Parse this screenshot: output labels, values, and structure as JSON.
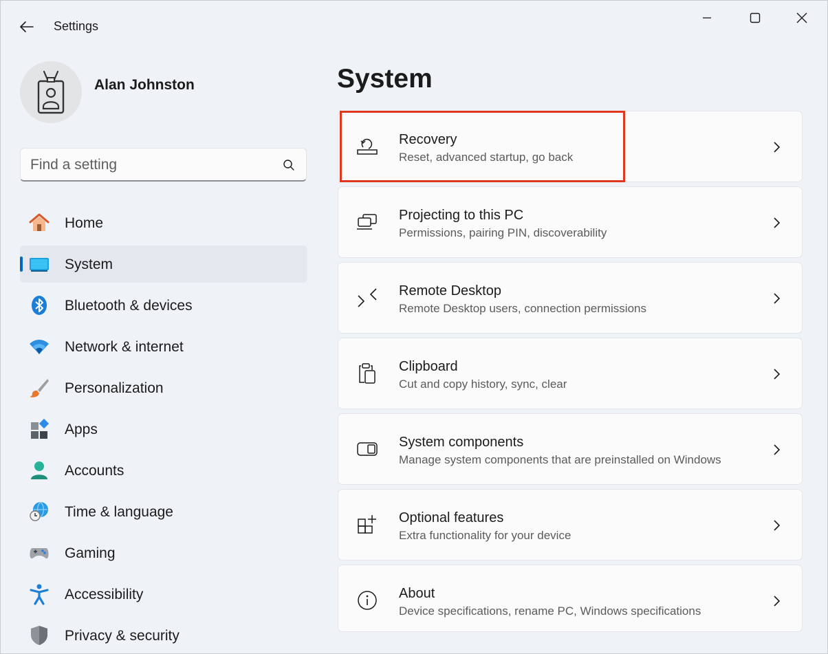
{
  "window": {
    "title": "Settings"
  },
  "user": {
    "name": "Alan Johnston"
  },
  "search": {
    "placeholder": "Find a setting",
    "value": ""
  },
  "nav": {
    "items": [
      {
        "label": "Home",
        "icon": "home-icon"
      },
      {
        "label": "System",
        "icon": "system-icon",
        "active": true
      },
      {
        "label": "Bluetooth & devices",
        "icon": "bluetooth-icon"
      },
      {
        "label": "Network & internet",
        "icon": "wifi-icon"
      },
      {
        "label": "Personalization",
        "icon": "brush-icon"
      },
      {
        "label": "Apps",
        "icon": "apps-icon"
      },
      {
        "label": "Accounts",
        "icon": "account-icon"
      },
      {
        "label": "Time & language",
        "icon": "globe-clock-icon"
      },
      {
        "label": "Gaming",
        "icon": "gamepad-icon"
      },
      {
        "label": "Accessibility",
        "icon": "accessibility-icon"
      },
      {
        "label": "Privacy & security",
        "icon": "shield-icon"
      }
    ]
  },
  "main": {
    "title": "System",
    "cards": [
      {
        "title": "Recovery",
        "subtitle": "Reset, advanced startup, go back",
        "icon": "recovery-icon"
      },
      {
        "title": "Projecting to this PC",
        "subtitle": "Permissions, pairing PIN, discoverability",
        "icon": "projecting-icon"
      },
      {
        "title": "Remote Desktop",
        "subtitle": "Remote Desktop users, connection permissions",
        "icon": "remote-desktop-icon"
      },
      {
        "title": "Clipboard",
        "subtitle": "Cut and copy history, sync, clear",
        "icon": "clipboard-icon"
      },
      {
        "title": "System components",
        "subtitle": "Manage system components that are preinstalled on Windows",
        "icon": "system-components-icon"
      },
      {
        "title": "Optional features",
        "subtitle": "Extra functionality for your device",
        "icon": "optional-features-icon"
      },
      {
        "title": "About",
        "subtitle": "Device specifications, rename PC, Windows specifications",
        "icon": "info-icon"
      }
    ]
  },
  "colors": {
    "accent": "#0067c0",
    "highlight": "#e2371f",
    "background": "#eff3f8",
    "card": "#fbfbfb"
  }
}
